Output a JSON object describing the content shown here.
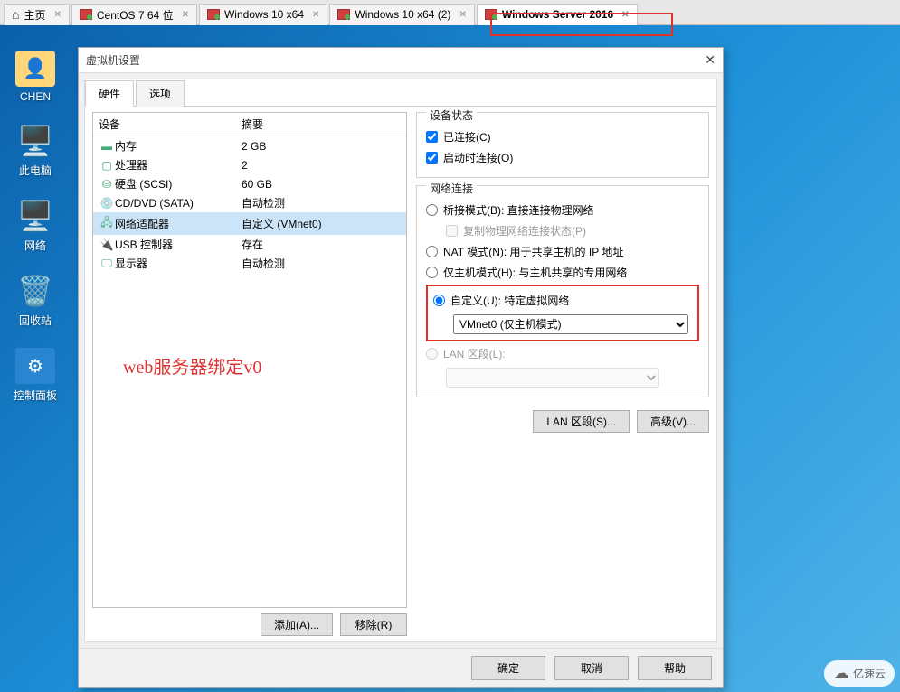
{
  "tabs": [
    {
      "label": "主页",
      "type": "home"
    },
    {
      "label": "CentOS 7 64 位",
      "type": "vm"
    },
    {
      "label": "Windows 10 x64",
      "type": "vm"
    },
    {
      "label": "Windows 10 x64 (2)",
      "type": "vm"
    },
    {
      "label": "Windows Server 2016",
      "type": "vm",
      "active": true
    }
  ],
  "desktop": [
    {
      "label": "CHEN",
      "glyph": "👤"
    },
    {
      "label": "此电脑",
      "glyph": "🖥️"
    },
    {
      "label": "网络",
      "glyph": "🖧"
    },
    {
      "label": "回收站",
      "glyph": "🗑️"
    },
    {
      "label": "控制面板",
      "glyph": "⚙️"
    }
  ],
  "dialog": {
    "title": "虚拟机设置",
    "inner_tabs": {
      "hardware": "硬件",
      "options": "选项"
    },
    "device_header": {
      "dev": "设备",
      "summary": "摘要"
    },
    "devices": [
      {
        "icon": "▬",
        "name": "内存",
        "summary": "2 GB"
      },
      {
        "icon": "▢",
        "name": "处理器",
        "summary": "2"
      },
      {
        "icon": "⛁",
        "name": "硬盘 (SCSI)",
        "summary": "60 GB"
      },
      {
        "icon": "💿",
        "name": "CD/DVD (SATA)",
        "summary": "自动检测"
      },
      {
        "icon": "🖧",
        "name": "网络适配器",
        "summary": "自定义 (VMnet0)",
        "selected": true
      },
      {
        "icon": "🔌",
        "name": "USB 控制器",
        "summary": "存在"
      },
      {
        "icon": "🖵",
        "name": "显示器",
        "summary": "自动检测"
      }
    ],
    "left_buttons": {
      "add": "添加(A)...",
      "remove": "移除(R)"
    },
    "device_status": {
      "legend": "设备状态",
      "connected": "已连接(C)",
      "connect_poweron": "启动时连接(O)"
    },
    "network": {
      "legend": "网络连接",
      "bridged": "桥接模式(B): 直接连接物理网络",
      "replicate": "复制物理网络连接状态(P)",
      "nat": "NAT 模式(N): 用于共享主机的 IP 地址",
      "hostonly": "仅主机模式(H): 与主机共享的专用网络",
      "custom": "自定义(U): 特定虚拟网络",
      "custom_value": "VMnet0 (仅主机模式)",
      "lan": "LAN 区段(L):"
    },
    "right_buttons": {
      "lan_segments": "LAN 区段(S)...",
      "advanced": "高级(V)..."
    },
    "footer": {
      "ok": "确定",
      "cancel": "取消",
      "help": "帮助"
    }
  },
  "annotation": "web服务器绑定v0",
  "watermark": "亿速云"
}
